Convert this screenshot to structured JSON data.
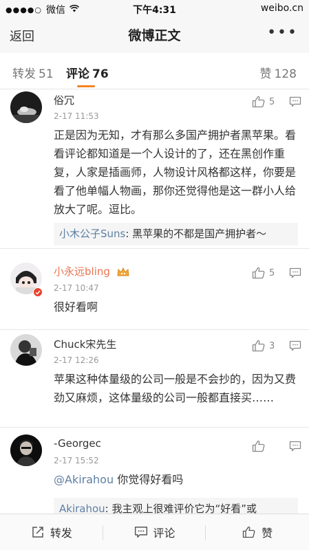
{
  "status_bar": {
    "carrier": "微信",
    "time": "下午4:31",
    "site": "weibo.cn"
  },
  "nav": {
    "back_label": "返回",
    "title": "微博正文",
    "more_label": "•••"
  },
  "tabs": {
    "repost": {
      "label": "转发",
      "count": "51"
    },
    "comment": {
      "label": "评论",
      "count": "76"
    },
    "like": {
      "label": "赞",
      "count": "128"
    }
  },
  "comments": [
    {
      "name": "俗冗",
      "time": "2-17 11:53",
      "likes": "5",
      "text": "正是因为无知，才有那么多国产拥护者黑苹果。看看评论都知道是一个人设计的了，还在黑创作重复，人家是插画师，人物设计风格都这样，你要是看了他单幅人物画，那你还觉得他是这一群小人给放大了呢。逗比。",
      "reply": {
        "who": "小木公子Suns",
        "text": ": 黑苹果的不都是国产拥护者～"
      }
    },
    {
      "name": "小永远bling",
      "time": "2-17 10:47",
      "likes": "5",
      "text": "很好看啊"
    },
    {
      "name": "Chuck宋先生",
      "time": "2-17 12:26",
      "likes": "3",
      "text": "苹果这种体量级的公司一般是不会抄的，因为又费劲又麻烦，这体量级的公司一般都直接买……"
    },
    {
      "name": "-Georgec",
      "time": "2-17 15:52",
      "mention": "@Akirahou",
      "text": " 你觉得好看吗",
      "reply": {
        "who": "Akirahou",
        "text": ": 我主观上很难评价它为“好看”或"
      }
    }
  ],
  "bottom_bar": {
    "repost": "转发",
    "comment": "评论",
    "like": "赞"
  }
}
